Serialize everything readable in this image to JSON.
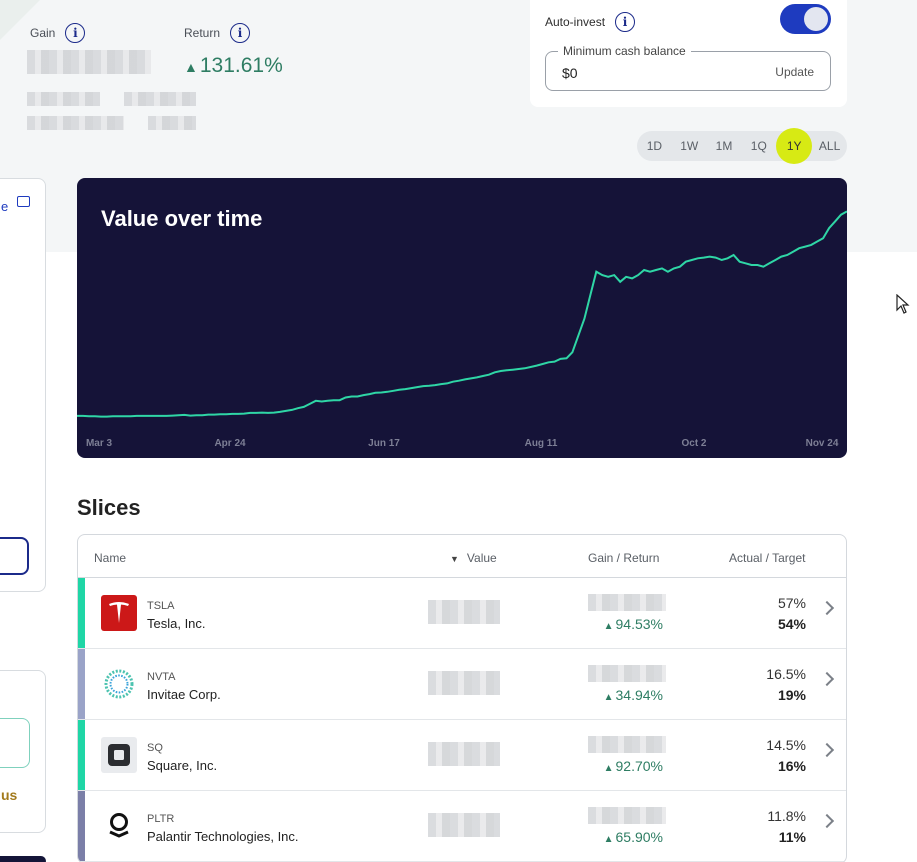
{
  "summary": {
    "gain_label": "Gain",
    "return_label": "Return",
    "return_value": "131.61%"
  },
  "auto_invest": {
    "label": "Auto-invest",
    "enabled": true,
    "min_cash_label": "Minimum cash balance",
    "min_cash_value": "$0",
    "update_label": "Update"
  },
  "time_range": {
    "options": [
      "1D",
      "1W",
      "1M",
      "1Q",
      "1Y",
      "ALL"
    ],
    "selected": "1Y"
  },
  "chart": {
    "title": "Value over time",
    "x_ticks": [
      "Mar 3",
      "Apr 24",
      "Jun 17",
      "Aug 11",
      "Oct 2",
      "Nov 24"
    ]
  },
  "chart_data": {
    "type": "line",
    "title": "Value over time",
    "x_ticks": [
      "Mar 3",
      "Apr 24",
      "Jun 17",
      "Aug 11",
      "Oct 2",
      "Nov 24"
    ],
    "series": [
      {
        "color": "#2fd6a6",
        "values": [
          1.0,
          1.0,
          0.99,
          0.99,
          0.98,
          0.98,
          0.99,
          0.99,
          0.99,
          0.99,
          1.0,
          1.0,
          1.0,
          1.0,
          1.0,
          1.0,
          1.01,
          1.02,
          1.03,
          1.01,
          1.02,
          1.02,
          1.04,
          1.04,
          1.05,
          1.05,
          1.06,
          1.06,
          1.07,
          1.09,
          1.09,
          1.1,
          1.09,
          1.1,
          1.12,
          1.15,
          1.18,
          1.23,
          1.27,
          1.36,
          1.45,
          1.43,
          1.45,
          1.47,
          1.47,
          1.55,
          1.58,
          1.58,
          1.62,
          1.65,
          1.69,
          1.7,
          1.72,
          1.75,
          1.78,
          1.8,
          1.83,
          1.86,
          1.89,
          1.9,
          1.92,
          1.95,
          1.97,
          2.02,
          2.05,
          2.09,
          2.12,
          2.15,
          2.19,
          2.23,
          2.3,
          2.34,
          2.36,
          2.38,
          2.4,
          2.42,
          2.46,
          2.5,
          2.55,
          2.6,
          2.62,
          2.7,
          2.72,
          2.9,
          3.4,
          3.9,
          4.6,
          5.3,
          5.2,
          5.15,
          5.2,
          5.0,
          5.15,
          5.1,
          5.2,
          5.35,
          5.3,
          5.35,
          5.4,
          5.3,
          5.4,
          5.45,
          5.6,
          5.65,
          5.7,
          5.72,
          5.75,
          5.72,
          5.65,
          5.7,
          5.8,
          5.6,
          5.55,
          5.5,
          5.5,
          5.45,
          5.55,
          5.65,
          5.75,
          5.8,
          5.9,
          6.0,
          6.05,
          6.1,
          6.2,
          6.3,
          6.6,
          6.8,
          7.0,
          7.1
        ]
      }
    ]
  },
  "slices": {
    "title": "Slices",
    "headers": {
      "name": "Name",
      "value": "Value",
      "gain_return": "Gain / Return",
      "actual_target": "Actual / Target"
    },
    "rows": [
      {
        "ticker": "TSLA",
        "company": "Tesla, Inc.",
        "return": "94.53%",
        "actual": "57%",
        "target": "54%",
        "bar_color": "#1fd6a6",
        "logo": "tesla-logo-icon"
      },
      {
        "ticker": "NVTA",
        "company": "Invitae Corp.",
        "return": "34.94%",
        "actual": "16.5%",
        "target": "19%",
        "bar_color": "#9aa3c8",
        "logo": "invitae-logo-icon"
      },
      {
        "ticker": "SQ",
        "company": "Square, Inc.",
        "return": "92.70%",
        "actual": "14.5%",
        "target": "16%",
        "bar_color": "#1fd6a6",
        "logo": "square-logo-icon"
      },
      {
        "ticker": "PLTR",
        "company": "Palantir Technologies, Inc.",
        "return": "65.90%",
        "actual": "11.8%",
        "target": "11%",
        "bar_color": "#7b7fa8",
        "logo": "palantir-logo-icon"
      }
    ]
  },
  "left_panel": {
    "link_fragment": "e",
    "text_fragment": "us"
  }
}
